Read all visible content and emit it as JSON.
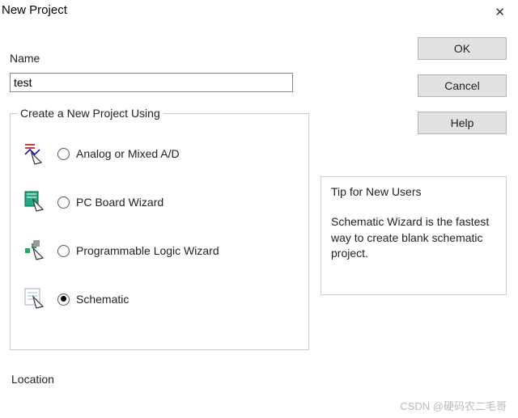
{
  "window": {
    "title": "New Project"
  },
  "name": {
    "label": "Name",
    "value": "test"
  },
  "options": {
    "legend": "Create a New Project Using",
    "items": [
      {
        "label": "Analog or Mixed A/D",
        "checked": false
      },
      {
        "label": "PC Board Wizard",
        "checked": false
      },
      {
        "label": "Programmable Logic Wizard",
        "checked": false
      },
      {
        "label": "Schematic",
        "checked": true
      }
    ],
    "selected": "Schematic"
  },
  "buttons": {
    "ok": "OK",
    "cancel": "Cancel",
    "help": "Help"
  },
  "tip": {
    "title": "Tip for New Users",
    "text": "Schematic Wizard is the fastest way to create blank schematic project."
  },
  "location": {
    "label": "Location"
  },
  "watermark": "CSDN @硬码农二毛哥"
}
